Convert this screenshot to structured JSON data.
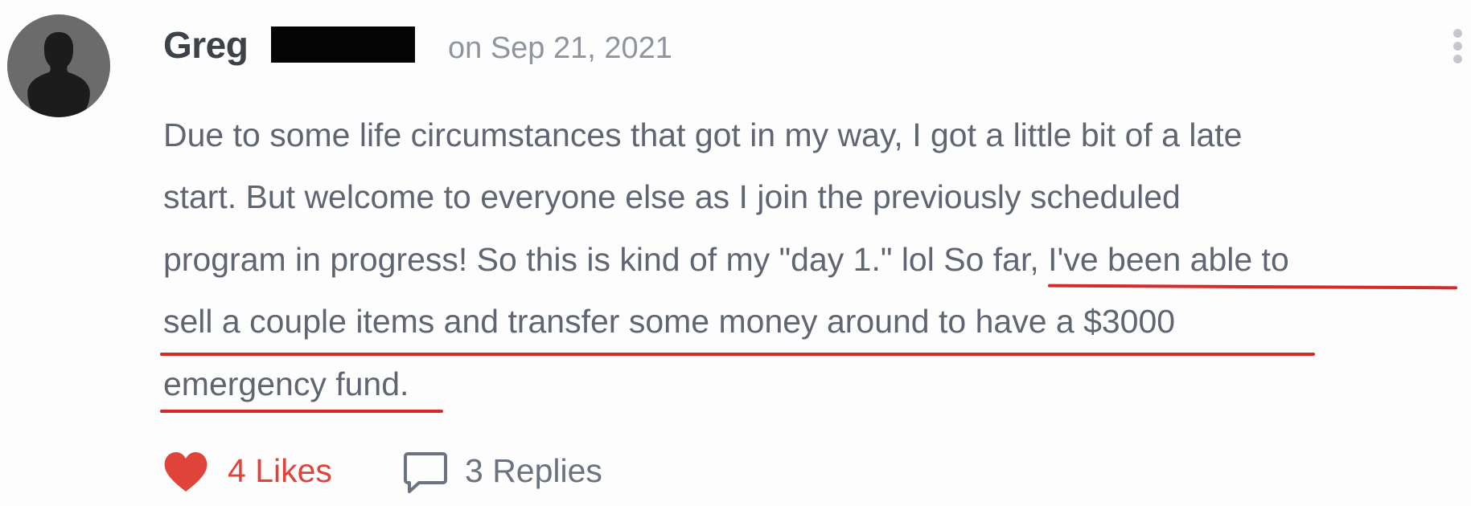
{
  "comment": {
    "author": "Greg",
    "date": "on Sep 21, 2021",
    "body_lines": [
      "Due to some life circumstances that got in my way, I got a little bit of a late",
      "start. But welcome to everyone else as I join the previously scheduled",
      "program in progress! So this is kind of my \"day 1.\" lol So far, I've been able to",
      "sell a couple items and transfer some money around to have a $3000",
      "emergency fund."
    ],
    "likes_label": "4 Likes",
    "replies_label": "3 Replies"
  },
  "icons": {
    "avatar": "default-user-silhouette",
    "more": "vertical-ellipsis-icon",
    "like": "heart-icon",
    "reply": "speech-bubble-icon"
  },
  "colors": {
    "highlight_underline": "#d42a2a",
    "like_accent": "#e0433a",
    "body_text": "#5f6672",
    "meta_text": "#8f959e"
  }
}
